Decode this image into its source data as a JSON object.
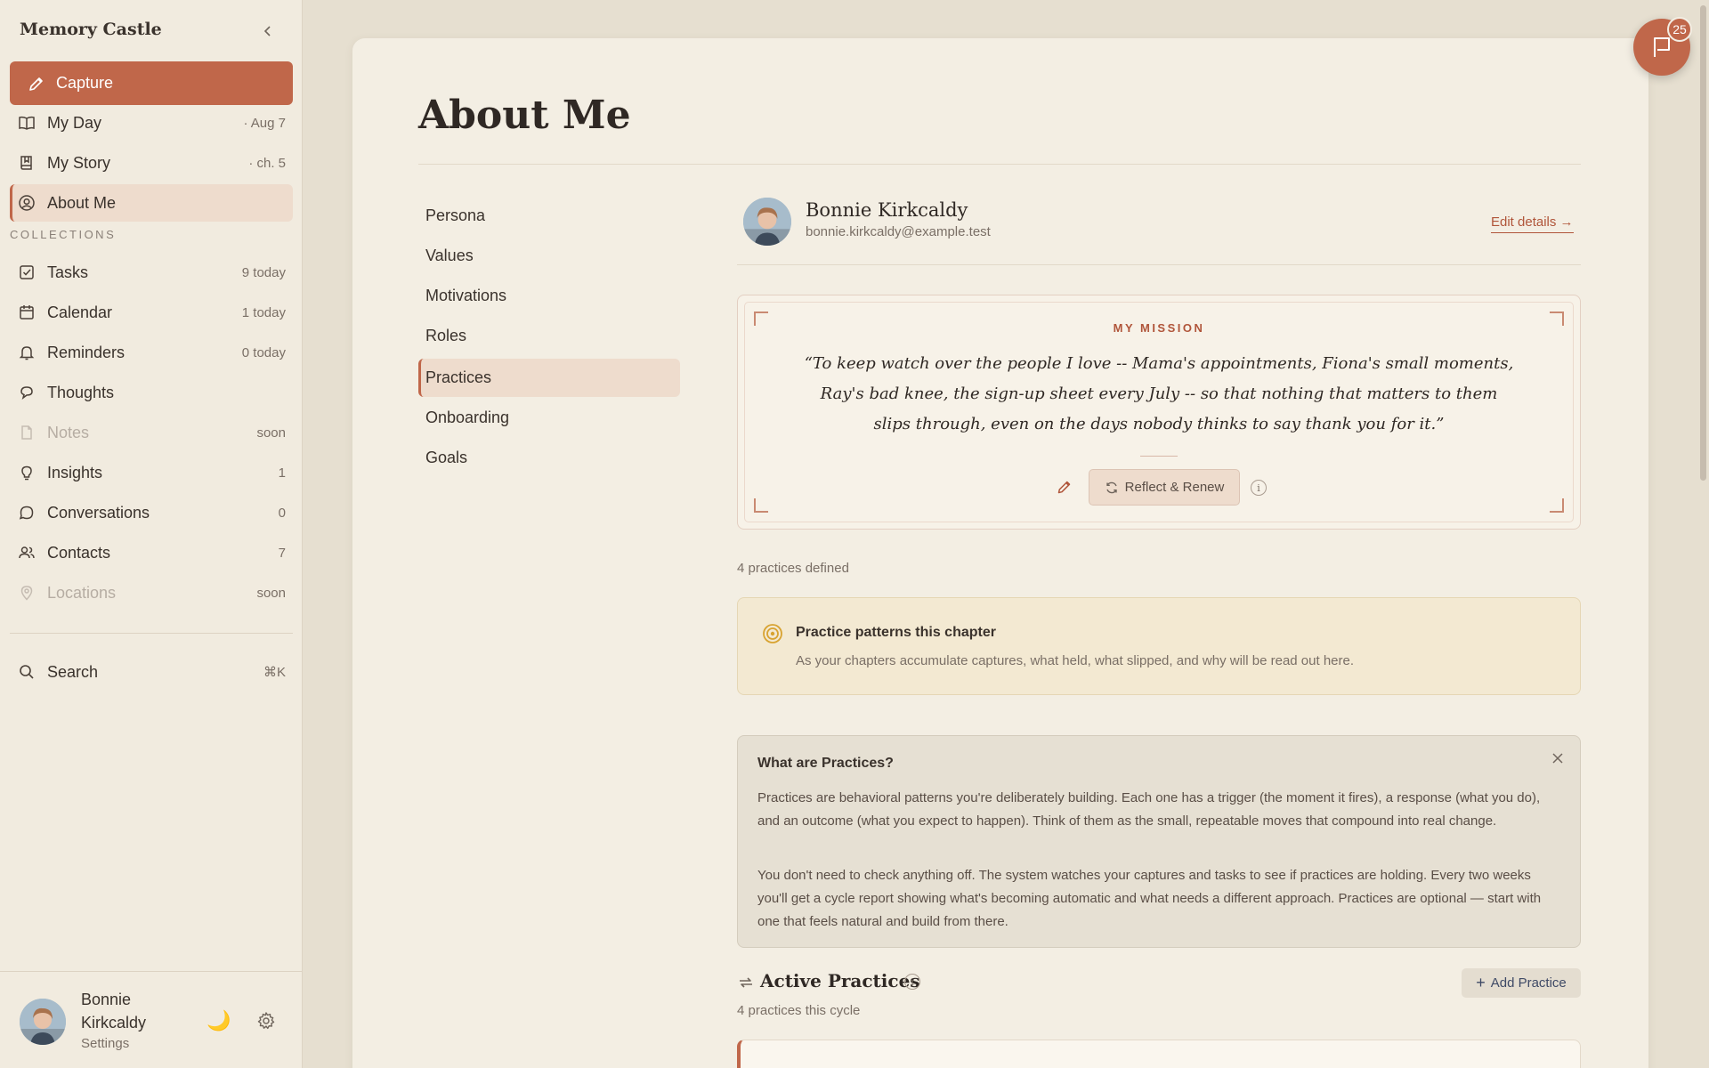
{
  "app": {
    "name": "Memory Castle"
  },
  "sidebar": {
    "capture_label": "Capture",
    "primary_items": [
      {
        "label": "My Day",
        "meta": "· Aug 7",
        "icon": "book-open-icon"
      },
      {
        "label": "My Story",
        "meta": "· ch. 5",
        "icon": "book-icon"
      },
      {
        "label": "About Me",
        "meta": "",
        "icon": "user-circle-icon",
        "active": true
      }
    ],
    "collections_label": "COLLECTIONS",
    "collection_items": [
      {
        "label": "Tasks",
        "meta": "9 today",
        "icon": "checkbox-icon"
      },
      {
        "label": "Calendar",
        "meta": "1 today",
        "icon": "calendar-icon"
      },
      {
        "label": "Reminders",
        "meta": "0 today",
        "icon": "bell-icon"
      },
      {
        "label": "Thoughts",
        "meta": "",
        "icon": "speech-bubble-icon"
      },
      {
        "label": "Notes",
        "meta": "soon",
        "icon": "note-icon",
        "disabled": true
      },
      {
        "label": "Insights",
        "meta": "1",
        "icon": "lightbulb-icon"
      },
      {
        "label": "Conversations",
        "meta": "0",
        "icon": "chat-icon"
      },
      {
        "label": "Contacts",
        "meta": "7",
        "icon": "people-icon"
      },
      {
        "label": "Locations",
        "meta": "soon",
        "icon": "map-pin-icon",
        "disabled": true
      }
    ],
    "search": {
      "label": "Search",
      "shortcut": "⌘K"
    },
    "user": {
      "name": "Bonnie Kirkcaldy",
      "settings_label": "Settings"
    }
  },
  "page": {
    "title": "About Me",
    "subnav": [
      "Persona",
      "Values",
      "Motivations",
      "Roles",
      "Practices",
      "Onboarding",
      "Goals"
    ],
    "subnav_active": "Practices",
    "profile": {
      "name": "Bonnie Kirkcaldy",
      "email": "bonnie.kirkcaldy@example.test",
      "edit_label": "Edit details →"
    },
    "mission": {
      "label": "MY MISSION",
      "quote": "“To keep watch over the people I love -- Mama's appointments, Fiona's small moments, Ray's bad knee, the sign-up sheet every July -- so that nothing that matters to them slips through, even on the days nobody thinks to say thank you for it.”",
      "renew_label": "Reflect & Renew",
      "info_glyph": "i"
    },
    "practices_count": "4 practices defined",
    "patterns": {
      "title": "Practice patterns this chapter",
      "description": "As your chapters accumulate captures, what held, what slipped, and why will be read out here."
    },
    "what_are": {
      "title": "What are Practices?",
      "p1": "Practices are behavioral patterns you're deliberately building. Each one has a trigger (the moment it fires), a response (what you do), and an outcome (what you expect to happen). Think of them as the small, repeatable moves that compound into real change.",
      "p2": "You don't need to check anything off. The system watches your captures and tasks to see if practices are holding. Every two weeks you'll get a cycle report showing what's becoming automatic and what needs a different approach. Practices are optional — start with one that feels natural and build from there."
    },
    "active": {
      "title": "Active Practices",
      "info_glyph": "i",
      "subtitle": "4 practices this cycle",
      "add_label": "Add Practice"
    }
  },
  "feedback": {
    "badge": "25"
  },
  "colors": {
    "accent": "#c0674a",
    "sidebar_bg": "#f1ebdf",
    "card_bg": "#f3eee3",
    "patterns_bg": "#f3e9d2"
  }
}
